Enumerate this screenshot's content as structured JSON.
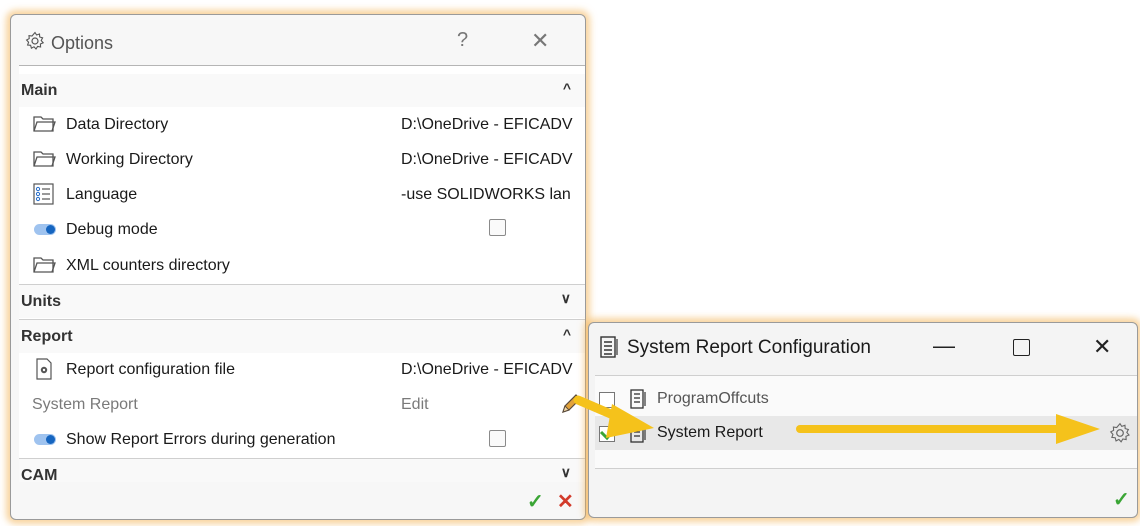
{
  "options_window": {
    "title": "Options",
    "help_label": "?",
    "close_label": "✕",
    "sections": {
      "main": {
        "label": "Main"
      },
      "units": {
        "label": "Units"
      },
      "report": {
        "label": "Report"
      },
      "cam": {
        "label": "CAM"
      }
    },
    "main_rows": {
      "data_dir": {
        "label": "Data Directory",
        "value": "D:\\OneDrive - EFICADV"
      },
      "working_dir": {
        "label": "Working Directory",
        "value": "D:\\OneDrive - EFICADV"
      },
      "language": {
        "label": "Language",
        "value": "-use SOLIDWORKS lan"
      },
      "debug": {
        "label": "Debug mode"
      },
      "xml_counters": {
        "label": "XML counters directory"
      }
    },
    "report_rows": {
      "config_file": {
        "label": "Report configuration file",
        "value": "D:\\OneDrive - EFICADV"
      },
      "system_report": {
        "label": "System Report",
        "value": "Edit"
      },
      "show_errors": {
        "label": "Show Report Errors during generation"
      }
    },
    "ok_symbol": "✓",
    "cancel_symbol": "✕"
  },
  "system_report_window": {
    "title": "System Report Configuration",
    "minimize_label": "—",
    "close_label": "✕",
    "items": [
      {
        "label": "ProgramOffcuts",
        "checked": false
      },
      {
        "label": "System Report",
        "checked": true
      }
    ],
    "ok_symbol": "✓"
  },
  "colors": {
    "window_glow": "#f2b050",
    "arrow": "#f5c21b",
    "ok": "#3aa535",
    "cancel": "#d23a2a",
    "toggle": "#1565c0"
  }
}
